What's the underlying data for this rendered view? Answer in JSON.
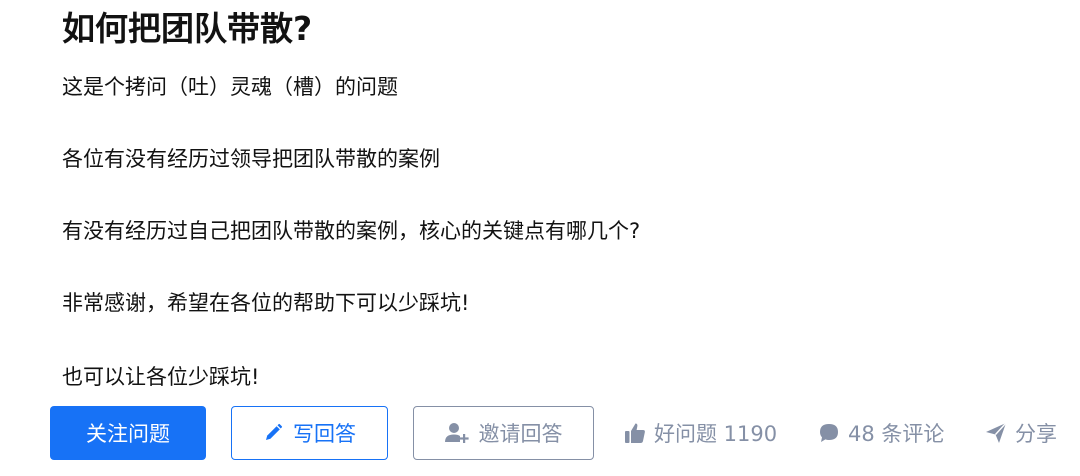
{
  "question": {
    "title": "如何把团队带散?",
    "paragraphs": [
      "这是个拷问（吐）灵魂（槽）的问题",
      "各位有没有经历过领导把团队带散的案例",
      "有没有经历过自己把团队带散的案例，核心的关键点有哪几个?",
      "非常感谢，希望在各位的帮助下可以少踩坑!",
      "也可以让各位少踩坑!"
    ]
  },
  "actions": {
    "follow_label": "关注问题",
    "write_label": "写回答",
    "invite_label": "邀请回答",
    "good_question_label": "好问题 1190",
    "comments_label": "48 条评论",
    "share_label": "分享"
  },
  "icons": {
    "write": "pencil-icon",
    "invite": "invite-user-icon",
    "good_question": "thumbs-up-icon",
    "comments": "comment-bubble-icon",
    "share": "paper-plane-icon"
  },
  "colors": {
    "primary": "#1772f6",
    "muted": "#8590a6",
    "text": "#121212"
  }
}
